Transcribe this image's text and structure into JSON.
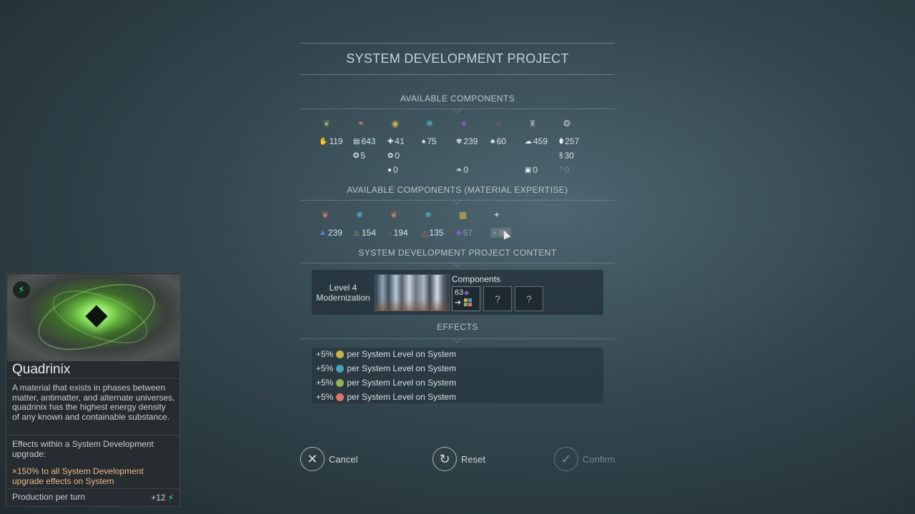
{
  "title": "SYSTEM DEVELOPMENT PROJECT",
  "available_components": {
    "heading": "AVAILABLE COMPONENTS",
    "columns": [
      {
        "cat_icon": "leaf-icon",
        "cat_color": "#8db65a",
        "rows": [
          {
            "icon": "hand-icon",
            "value": "119"
          }
        ]
      },
      {
        "cat_icon": "molecule-icon",
        "cat_color": "#d9786a",
        "rows": [
          {
            "icon": "grid-icon",
            "value": "643"
          },
          {
            "icon": "gear-icon",
            "value": "5"
          }
        ]
      },
      {
        "cat_icon": "coin-icon",
        "cat_color": "#c8b24a",
        "rows": [
          {
            "icon": "cross-icon",
            "value": "41"
          },
          {
            "icon": "flower-icon",
            "value": "0"
          },
          {
            "icon": "drop-icon",
            "value": "0"
          }
        ]
      },
      {
        "cat_icon": "atom-icon",
        "cat_color": "#4aa0b8",
        "rows": [
          {
            "icon": "mushroom-icon",
            "value": "75"
          }
        ]
      },
      {
        "cat_icon": "star-icon",
        "cat_color": "#8a5ec8",
        "rows": [
          {
            "icon": "lotus-icon",
            "value": "239"
          },
          {
            "icon": "feather-icon",
            "value": "0"
          }
        ]
      },
      {
        "cat_icon": "thumb-icon",
        "cat_color": "#c868a8",
        "rows": [
          {
            "icon": "tree-icon",
            "value": "60"
          }
        ]
      },
      {
        "cat_icon": "people-icon",
        "cat_color": "#9aa4a8",
        "rows": [
          {
            "icon": "cloud-icon",
            "value": "459"
          },
          {
            "icon": "box-icon",
            "value": "0"
          }
        ]
      },
      {
        "cat_icon": "circles-icon",
        "cat_color": "#b8c2c6",
        "rows": [
          {
            "icon": "egg-icon",
            "value": "257"
          },
          {
            "icon": "dna-icon",
            "value": "30"
          },
          {
            "icon": "question-icon",
            "value": "0"
          }
        ]
      }
    ]
  },
  "expertise": {
    "heading": "AVAILABLE COMPONENTS (MATERIAL EXPERTISE)",
    "items": [
      {
        "cat_icon": "leaf-icon",
        "cat_color": "#d9786a",
        "res_icon": "crystal-icon",
        "res_color": "#4a8ae0",
        "value": "239"
      },
      {
        "cat_icon": "atom-icon",
        "cat_color": "#4aa0b8",
        "res_icon": "fire-icon",
        "res_color": "#e0b040",
        "value": "154"
      },
      {
        "cat_icon": "leaf-icon",
        "cat_color": "#d9786a",
        "res_icon": "hat-icon",
        "res_color": "#d0306a",
        "value": "194"
      },
      {
        "cat_icon": "atom-icon",
        "cat_color": "#4aa0b8",
        "res_icon": "triangle-icon",
        "res_color": "#e06a50",
        "value": "135"
      },
      {
        "cat_icon": "squares-icon",
        "cat_color": "#c8b24a",
        "res_icon": "gem-icon",
        "res_color": "#8a5ec8",
        "value": "67"
      },
      {
        "cat_icon": "sparkle-icon",
        "cat_color": "#b8c2c6",
        "res_icon": "bolt-icon",
        "res_color": "#3fe07a",
        "value": "84"
      }
    ]
  },
  "content": {
    "heading": "SYSTEM DEVELOPMENT PROJECT CONTENT",
    "level_line1": "Level 4",
    "level_line2": "Modernization",
    "components_label": "Components",
    "slot1_value": "63",
    "slot_empty": "?"
  },
  "effects": {
    "heading": "EFFECTS",
    "rows": [
      {
        "prefix": "+5%",
        "icon": "coin-icon",
        "color": "#c8b24a",
        "text": "per System Level on System"
      },
      {
        "prefix": "+5%",
        "icon": "atom-icon",
        "color": "#4aa0b8",
        "text": "per System Level on System"
      },
      {
        "prefix": "+5%",
        "icon": "leaf-icon",
        "color": "#8db65a",
        "text": "per System Level on System"
      },
      {
        "prefix": "+5%",
        "icon": "molecule-icon",
        "color": "#d9786a",
        "text": "per System Level on System"
      }
    ]
  },
  "buttons": {
    "cancel": "Cancel",
    "reset": "Reset",
    "confirm": "Confirm"
  },
  "card": {
    "title": "Quadrinix",
    "description": "A material that exists in phases between matter, antimatter, and alternate universes, quadrinix has the highest energy density of any known and containable substance.",
    "effects_heading": "Effects within a System Development upgrade:",
    "effect_text": "×150% to all System Development upgrade effects on System",
    "production_label": "Production per turn",
    "production_value": "+12"
  }
}
